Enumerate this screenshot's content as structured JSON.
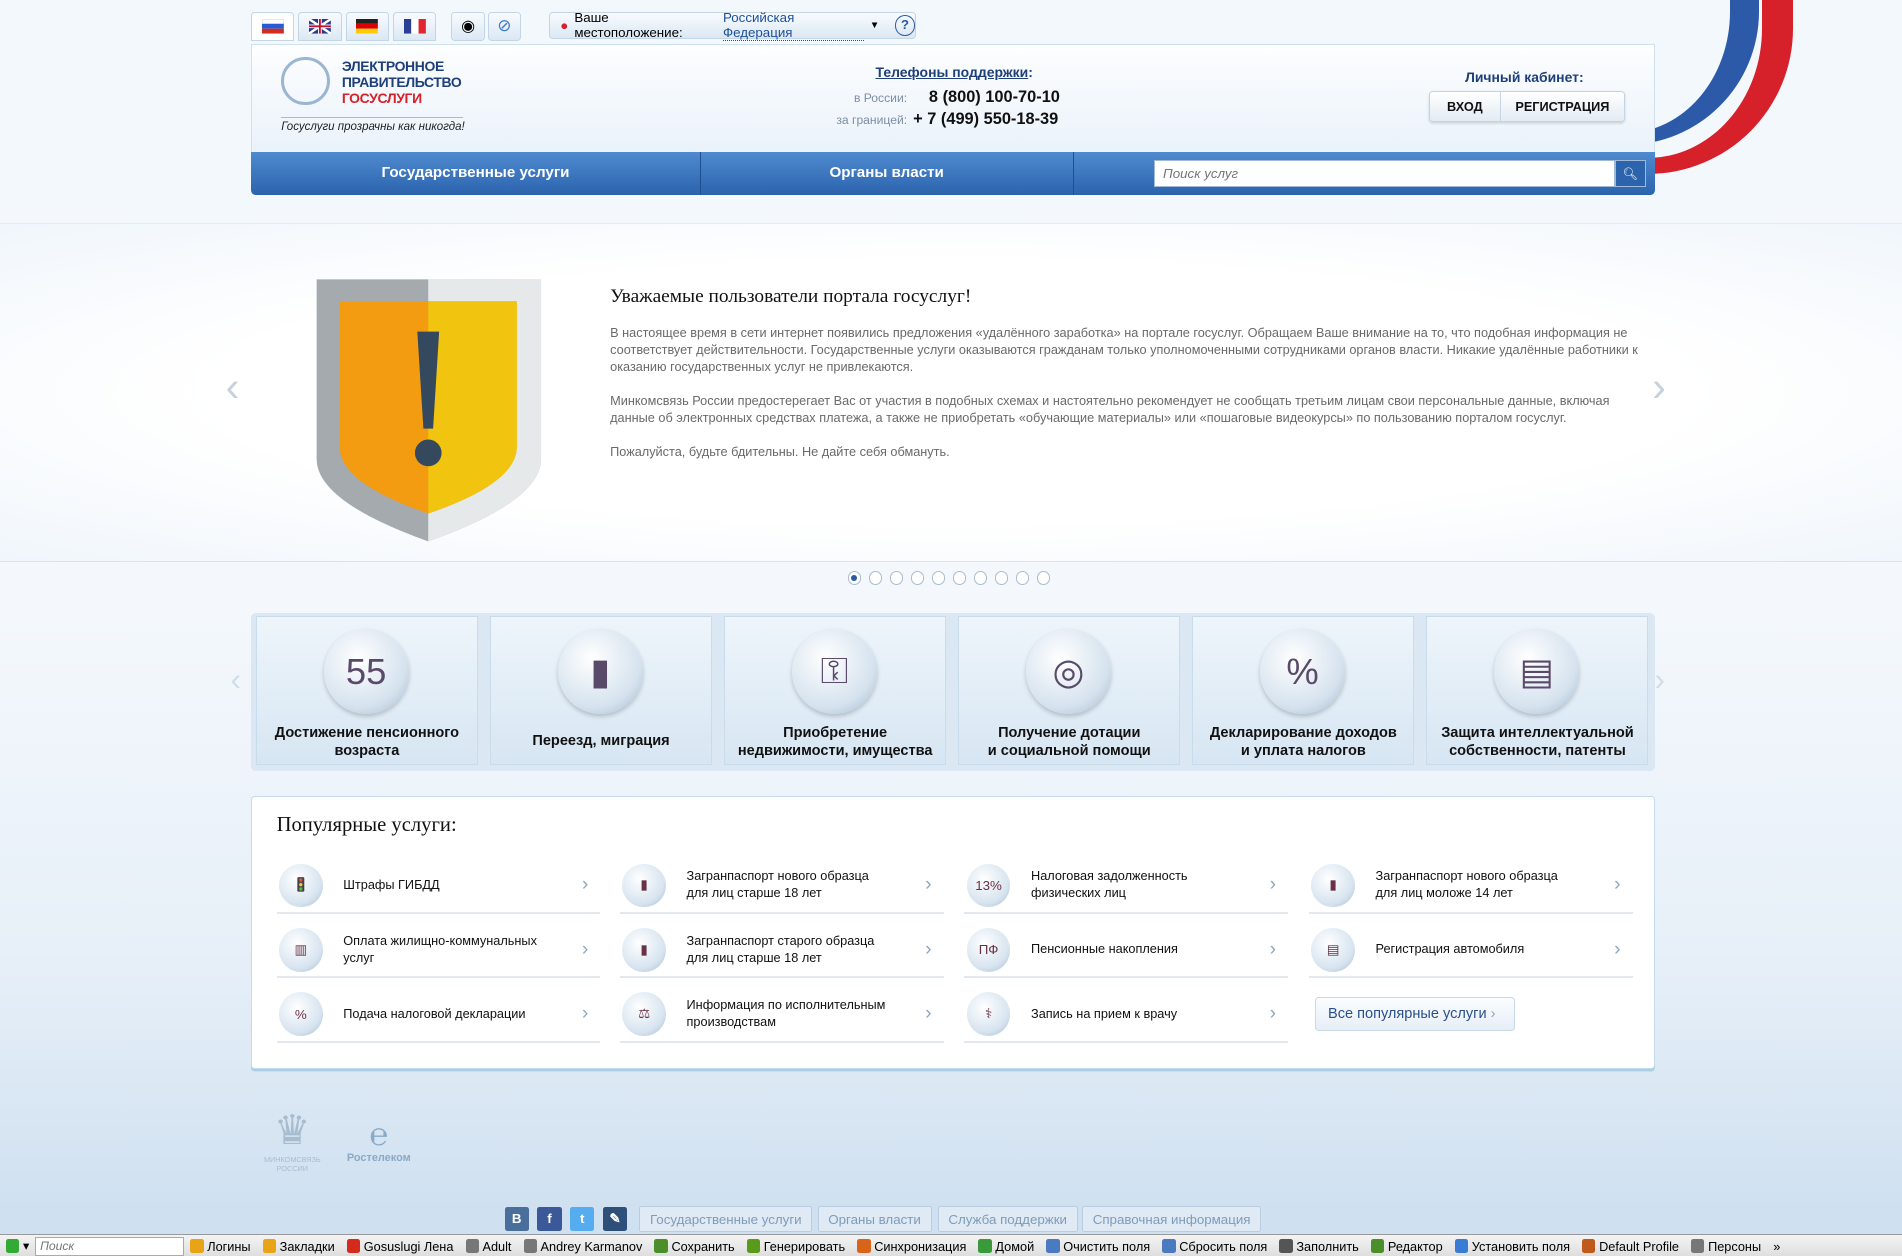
{
  "top": {
    "languages": [
      "ru",
      "en",
      "de",
      "fr"
    ],
    "location_label": "Ваше местоположение:",
    "location_value": "Российская Федерация",
    "help": "?"
  },
  "header": {
    "logo_line1": "ЭЛЕКТРОННОЕ",
    "logo_line2": "ПРАВИТЕЛЬСТВО",
    "logo_line3": "ГОСУСЛУГИ",
    "slogan": "Госуслуги прозрачны как никогда!",
    "support_title": "Телефоны поддержки",
    "support_colon": ":",
    "russia_label": "в России:",
    "russia_phone": "8 (800) 100-70-10",
    "abroad_label": "за границей:",
    "abroad_phone": "+ 7 (499) 550-18-39",
    "cabinet_label": "Личный кабинет:",
    "login": "ВХОД",
    "register": "РЕГИСТРАЦИЯ"
  },
  "nav": {
    "items": [
      "Государственные услуги",
      "Органы власти"
    ],
    "search_placeholder": "Поиск услуг"
  },
  "banner": {
    "title": "Уважаемые пользователи портала госуслуг!",
    "paragraphs": [
      "В настоящее время в сети интернет появились предложения «удалённого заработка» на портале госуслуг. Обращаем Ваше внимание на то, что подобная информация не соответствует действительности. Государственные услуги оказываются гражданам только уполномоченными сотрудниками органов власти. Никакие удалённые работники к оказанию государственных услуг не привлекаются.",
      "Минкомсвязь России предостерегает Вас от участия в подобных схемах и настоятельно рекомендует не сообщать третьим лицам свои персональные данные, включая данные об электронных средствах платежа, а также не приобретать «обучающие материалы» или «пошаговые видеокурсы» по пользованию порталом госуслуг.",
      "Пожалуйста, будьте бдительны. Не дайте себя обмануть."
    ],
    "slide_count": 10,
    "active_slide": 1
  },
  "categories": [
    {
      "line1": "Достижение пенсионного",
      "line2": "возраста",
      "icon": "55"
    },
    {
      "line1": "Переезд, миграция",
      "line2": "",
      "icon": "▮"
    },
    {
      "line1": "Приобретение",
      "line2": "недвижимости, имущества",
      "icon": "⚿"
    },
    {
      "line1": "Получение дотации",
      "line2": "и социальной помощи",
      "icon": "◎"
    },
    {
      "line1": "Декларирование доходов",
      "line2": "и уплата налогов",
      "icon": "%"
    },
    {
      "line1": "Защита интеллектуальной",
      "line2": "собственности, патенты",
      "icon": "▤"
    }
  ],
  "popular": {
    "title": "Популярные услуги:",
    "all_label": "Все популярные услуги",
    "items": [
      {
        "line1": "Штрафы ГИБДД",
        "line2": "",
        "icon": "🚦"
      },
      {
        "line1": "Загранпаспорт нового образца",
        "line2": "для лиц старше 18 лет",
        "icon": "▮"
      },
      {
        "line1": "Налоговая задолженность",
        "line2": "физических лиц",
        "icon": "13%"
      },
      {
        "line1": "Загранпаспорт нового образца",
        "line2": "для лиц моложе 14 лет",
        "icon": "▮"
      },
      {
        "line1": "Оплата жилищно-коммунальных",
        "line2": "услуг",
        "icon": "▥"
      },
      {
        "line1": "Загранпаспорт старого образца",
        "line2": "для лиц старше 18 лет",
        "icon": "▮"
      },
      {
        "line1": "Пенсионные накопления",
        "line2": "",
        "icon": "ПФ"
      },
      {
        "line1": "Регистрация автомобиля",
        "line2": "",
        "icon": "▤"
      },
      {
        "line1": "Подача налоговой декларации",
        "line2": "",
        "icon": "%"
      },
      {
        "line1": "Информация по исполнительным",
        "line2": "производствам",
        "icon": "⚖"
      },
      {
        "line1": "Запись на прием к врачу",
        "line2": "",
        "icon": "⚕"
      }
    ]
  },
  "footer": {
    "minkom": "МИНКОМСВЯЗЬ РОССИИ",
    "rostelecom": "Ростелеком",
    "social": [
      "В",
      "f",
      "t",
      "✎"
    ],
    "links": [
      "Государственные услуги",
      "Органы власти",
      "Служба поддержки",
      "Справочная информация"
    ]
  },
  "toolbar": {
    "search_placeholder": "Поиск",
    "items": [
      "Логины",
      "Закладки",
      "Gosuslugi Лена",
      "Adult",
      "Andrey Karmanov",
      "Сохранить",
      "Генерировать",
      "Синхронизация",
      "Домой",
      "Очистить поля",
      "Сбросить поля",
      "Заполнить",
      "Редактор",
      "Установить поля",
      "Default Profile",
      "Персоны"
    ],
    "more": "»"
  },
  "colors": {
    "nav": "#2b64ad",
    "link": "#1f4f9a",
    "red": "#d6202a"
  }
}
